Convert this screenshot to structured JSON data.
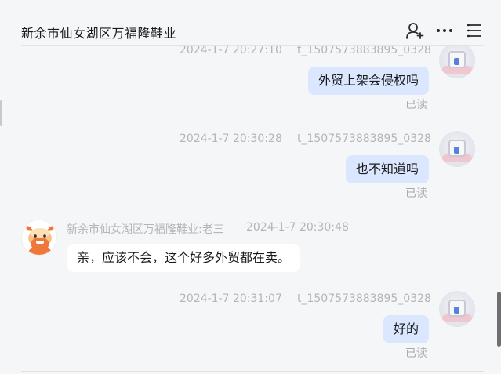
{
  "header": {
    "title": "新余市仙女湖区万福隆鞋业",
    "icons": [
      "add-user-icon",
      "more-icon",
      "menu-icon"
    ]
  },
  "messages": [
    {
      "time": "2024-1-7 20:27:10",
      "user": "t_1507573883895_0328",
      "text": "外贸上架会侵权吗",
      "read": "已读"
    },
    {
      "time": "2024-1-7 20:30:28",
      "user": "t_1507573883895_0328",
      "text": "也不知道吗",
      "read": "已读"
    },
    {
      "sender": "新余市仙女湖区万福隆鞋业:老三",
      "time": "2024-1-7 20:30:48",
      "text": "亲，应该不会，这个好多外贸都在卖。"
    },
    {
      "time": "2024-1-7 20:31:07",
      "user": "t_1507573883895_0328",
      "text": "好的",
      "read": "已读"
    }
  ],
  "colors": {
    "background": "#f5f6f8",
    "self_bubble": "#dbe6ff",
    "other_bubble": "#ffffff",
    "meta_text": "#b3b5ba",
    "avatar_orange": "#f0773a"
  }
}
